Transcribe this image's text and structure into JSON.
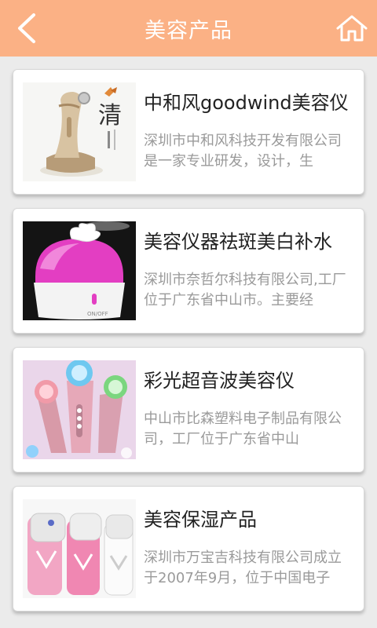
{
  "header": {
    "title": "美容产品",
    "back_icon": "back-arrow-icon",
    "home_icon": "home-icon",
    "bg_color": "#fbb185"
  },
  "products": [
    {
      "title": "中和风goodwind美容仪",
      "desc": "深圳市中和风科技开发有限公司是一家专业研发，设计，生",
      "image": "champagne-gold-beauty-device-image"
    },
    {
      "title": "美容仪器祛斑美白补水",
      "desc": "深圳市奈哲尔科技有限公司,工厂位于广东省中山市。主要经",
      "image": "pink-facial-steamer-image"
    },
    {
      "title": "彩光超音波美容仪",
      "desc": "中山市比森塑料电子制品有限公司，工厂位于广东省中山",
      "image": "color-light-ultrasonic-devices-image"
    },
    {
      "title": "美容保湿产品",
      "desc": "深圳市万宝吉科技有限公司成立于2007年9月，位于中国电子",
      "image": "nano-mist-sprayers-image"
    }
  ]
}
